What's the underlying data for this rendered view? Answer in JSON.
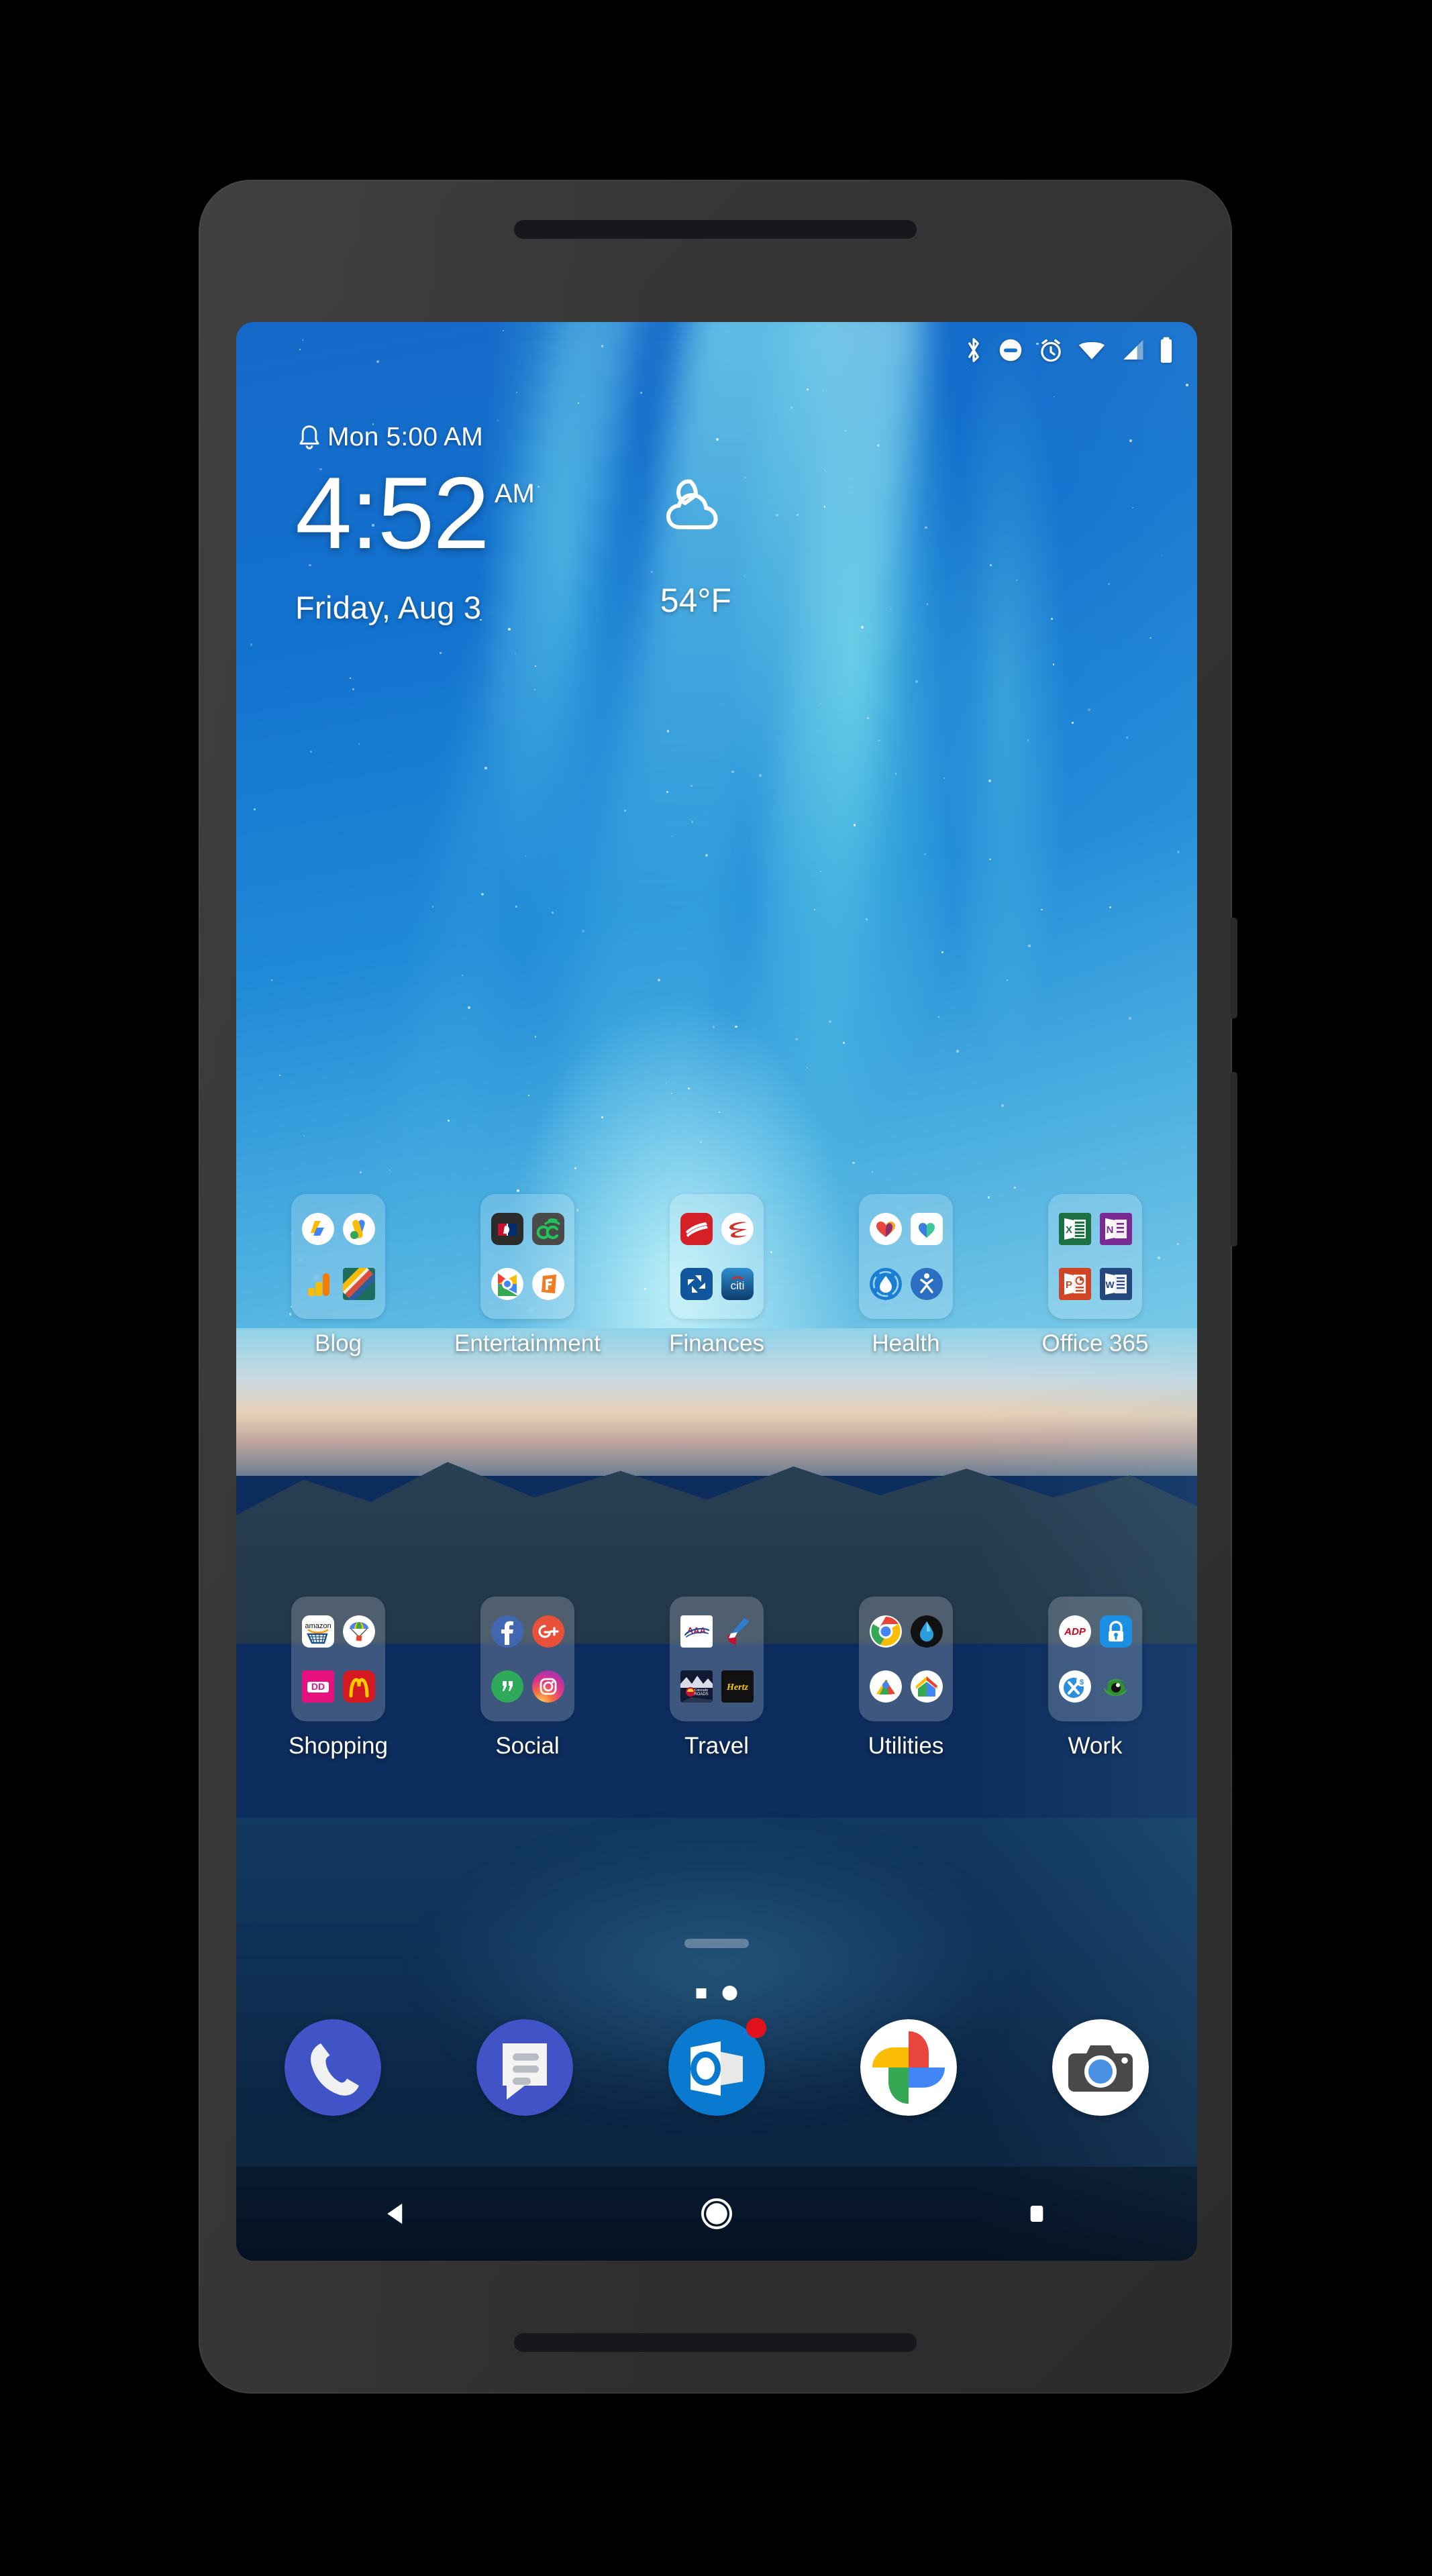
{
  "device": {
    "frame_label": "android-phone",
    "earpiece": "speaker-grille",
    "front_camera": "front-camera"
  },
  "status_bar": {
    "icons": [
      {
        "name": "bluetooth-icon",
        "label": "Bluetooth"
      },
      {
        "name": "do-not-disturb-icon",
        "label": "Do Not Disturb"
      },
      {
        "name": "alarm-icon",
        "label": "Alarm set"
      },
      {
        "name": "wifi-icon",
        "label": "Wi-Fi"
      },
      {
        "name": "cellular-signal-icon",
        "label": "Cellular signal"
      },
      {
        "name": "battery-icon",
        "label": "Battery"
      }
    ]
  },
  "widget": {
    "alarm_icon": "bell-icon",
    "alarm_text": "Mon 5:00 AM",
    "time": "4:52",
    "ampm": "AM",
    "date": "Friday, Aug 3",
    "weather_icon": "moon-cloud-icon",
    "temperature": "54°F"
  },
  "home_screen": {
    "folder_rows": [
      {
        "row": 1,
        "folders": [
          {
            "label": "Blog",
            "apps": [
              "adsense-icon",
              "google-ads-icon",
              "google-analytics-icon",
              "blogger-tile-icon"
            ]
          },
          {
            "label": "Entertainment",
            "apps": [
              "mlb-icon",
              "xfinity-cc-icon",
              "google-play-icon",
              "fandango-icon"
            ]
          },
          {
            "label": "Finances",
            "apps": [
              "bank-of-america-icon",
              "capital-one-icon",
              "chase-icon",
              "citi-icon"
            ]
          },
          {
            "label": "Health",
            "apps": [
              "samsung-health-icon",
              "fitness-icon",
              "water-tracker-icon",
              "body-fitness-icon"
            ]
          },
          {
            "label": "Office 365",
            "apps": [
              "excel-icon",
              "onenote-icon",
              "powerpoint-icon",
              "word-icon"
            ]
          }
        ]
      },
      {
        "row": 2,
        "folders": [
          {
            "label": "Shopping",
            "apps": [
              "amazon-icon",
              "google-express-icon",
              "dunkin-donuts-icon",
              "mcdonalds-icon"
            ]
          },
          {
            "label": "Social",
            "apps": [
              "facebook-icon",
              "google-plus-icon",
              "hangouts-icon",
              "instagram-icon"
            ]
          },
          {
            "label": "Travel",
            "apps": [
              "aaa-icon",
              "american-airlines-icon",
              "colorado-roads-icon",
              "hertz-icon"
            ]
          },
          {
            "label": "Utilities",
            "apps": [
              "chrome-icon",
              "dark-sky-icon",
              "google-maps-icon",
              "google-home-icon"
            ]
          },
          {
            "label": "Work",
            "apps": [
              "adp-icon",
              "authenticator-icon",
              "expense-icon",
              "eye-icon"
            ]
          }
        ]
      }
    ],
    "drag_handle": "drag-handle",
    "page_indicator": {
      "pages": 2,
      "current_page": 2,
      "home_page_marker": "square",
      "active_marker": "circle"
    }
  },
  "dock": {
    "items": [
      {
        "name": "phone-app",
        "label": "Phone"
      },
      {
        "name": "messages-app",
        "label": "Messages"
      },
      {
        "name": "outlook-app",
        "label": "Outlook",
        "badge": true
      },
      {
        "name": "google-photos-app",
        "label": "Photos"
      },
      {
        "name": "camera-app",
        "label": "Camera"
      }
    ]
  },
  "nav_bar": {
    "buttons": [
      {
        "name": "back-button",
        "label": "Back"
      },
      {
        "name": "home-button",
        "label": "Home"
      },
      {
        "name": "recents-button",
        "label": "Recents"
      }
    ]
  },
  "colors": {
    "accent_blue": "#1a73e8",
    "badge_red": "#e1121c",
    "wallpaper_sky": "#1272cf",
    "wallpaper_water": "#0f3156",
    "frame_gray": "#323232"
  }
}
